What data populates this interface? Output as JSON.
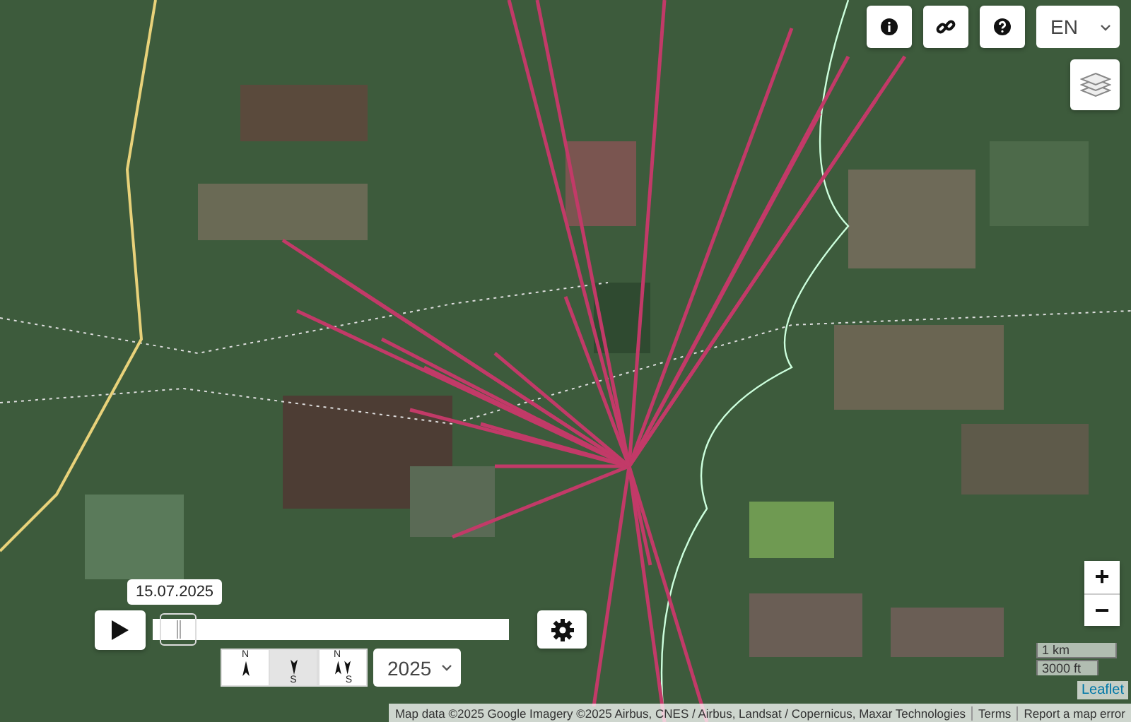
{
  "top_buttons": [
    {
      "kind": "info"
    },
    {
      "kind": "link"
    },
    {
      "kind": "help"
    }
  ],
  "language_select": {
    "value": "EN"
  },
  "timeline": {
    "date": "15.07.2025",
    "level": 0.02
  },
  "direction_buttons": [
    {
      "kind": "north",
      "selected": false,
      "top": "N"
    },
    {
      "kind": "south",
      "selected": true,
      "bottom": "S"
    },
    {
      "kind": "both",
      "selected": false,
      "top": "N",
      "bottom": "S"
    }
  ],
  "year_select": {
    "value": "2025"
  },
  "zoom": {
    "in": "+",
    "out": "−"
  },
  "scale": {
    "metric": "1 km",
    "imperial": "3000 ft"
  },
  "leaflet_link": "Leaflet",
  "attribution": {
    "text": "Map data ©2025 Google Imagery ©2025 Airbus, CNES / Airbus, Landsat / Copernicus, Maxar Technologies",
    "links": [
      "Terms",
      "Report a map error"
    ]
  }
}
